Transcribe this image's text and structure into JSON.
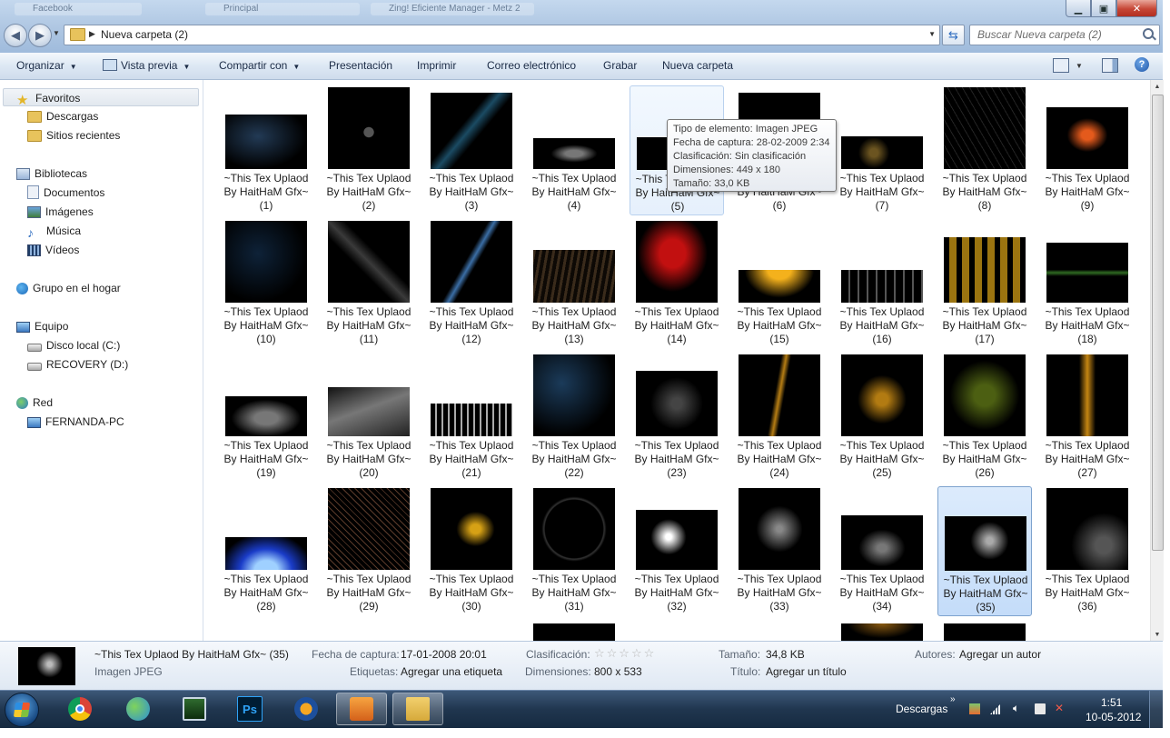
{
  "window": {
    "ghost_tabs": [
      "Facebook",
      "Principal",
      "Zing! Eficiente Manager - Metz 2"
    ]
  },
  "address": {
    "folder_name": "Nueva carpeta (2)",
    "search_placeholder": "Buscar Nueva carpeta (2)"
  },
  "toolbar": {
    "organize": "Organizar",
    "preview": "Vista previa",
    "share": "Compartir con",
    "presentation": "Presentación",
    "print": "Imprimir",
    "email": "Correo electrónico",
    "burn": "Grabar",
    "new_folder": "Nueva carpeta"
  },
  "sidebar": {
    "favorites": "Favoritos",
    "downloads": "Descargas",
    "recent": "Sitios recientes",
    "libraries": "Bibliotecas",
    "documents": "Documentos",
    "images": "Imágenes",
    "music": "Música",
    "videos": "Vídeos",
    "homegroup": "Grupo en el hogar",
    "computer": "Equipo",
    "local_disk": "Disco local (C:)",
    "recovery": "RECOVERY (D:)",
    "network": "Red",
    "pc": "FERNANDA-PC"
  },
  "files": {
    "name_line1": "~This Tex Uplaod",
    "name_line2": "By HaitHaM Gfx~",
    "numbers": [
      "(1)",
      "(2)",
      "(3)",
      "(4)",
      "(5)",
      "(6)",
      "(7)",
      "(8)",
      "(9)",
      "(10)",
      "(11)",
      "(12)",
      "(13)",
      "(14)",
      "(15)",
      "(16)",
      "(17)",
      "(18)",
      "(19)",
      "(20)",
      "(21)",
      "(22)",
      "(23)",
      "(24)",
      "(25)",
      "(26)",
      "(27)",
      "(28)",
      "(29)",
      "(30)",
      "(31)",
      "(32)",
      "(33)",
      "(34)",
      "(35)",
      "(36)"
    ],
    "selected": "(35)",
    "hovered": "(5)"
  },
  "tooltip": {
    "type": "Tipo de elemento: Imagen JPEG",
    "date": "Fecha de captura: 28-02-2009 2:34",
    "rating": "Clasificación: Sin clasificación",
    "dimensions": "Dimensiones: 449 x 180",
    "size": "Tamaño: 33,0 KB"
  },
  "details": {
    "filename": "~This Tex Uplaod By HaitHaM Gfx~ (35)",
    "filetype": "Imagen JPEG",
    "date_label": "Fecha de captura:",
    "date_value": "17-01-2008 20:01",
    "tags_label": "Etiquetas:",
    "tags_value": "Agregar una etiqueta",
    "rating_label": "Clasificación:",
    "rating_stars": "☆☆☆☆☆",
    "dimensions_label": "Dimensiones:",
    "dimensions_value": "800 x 533",
    "size_label": "Tamaño:",
    "size_value": "34,8 KB",
    "title_label": "Título:",
    "title_value": "Agregar un título",
    "authors_label": "Autores:",
    "authors_value": "Agregar un autor"
  },
  "taskbar": {
    "tray_label": "Descargas",
    "time": "1:51",
    "date": "10-05-2012"
  }
}
